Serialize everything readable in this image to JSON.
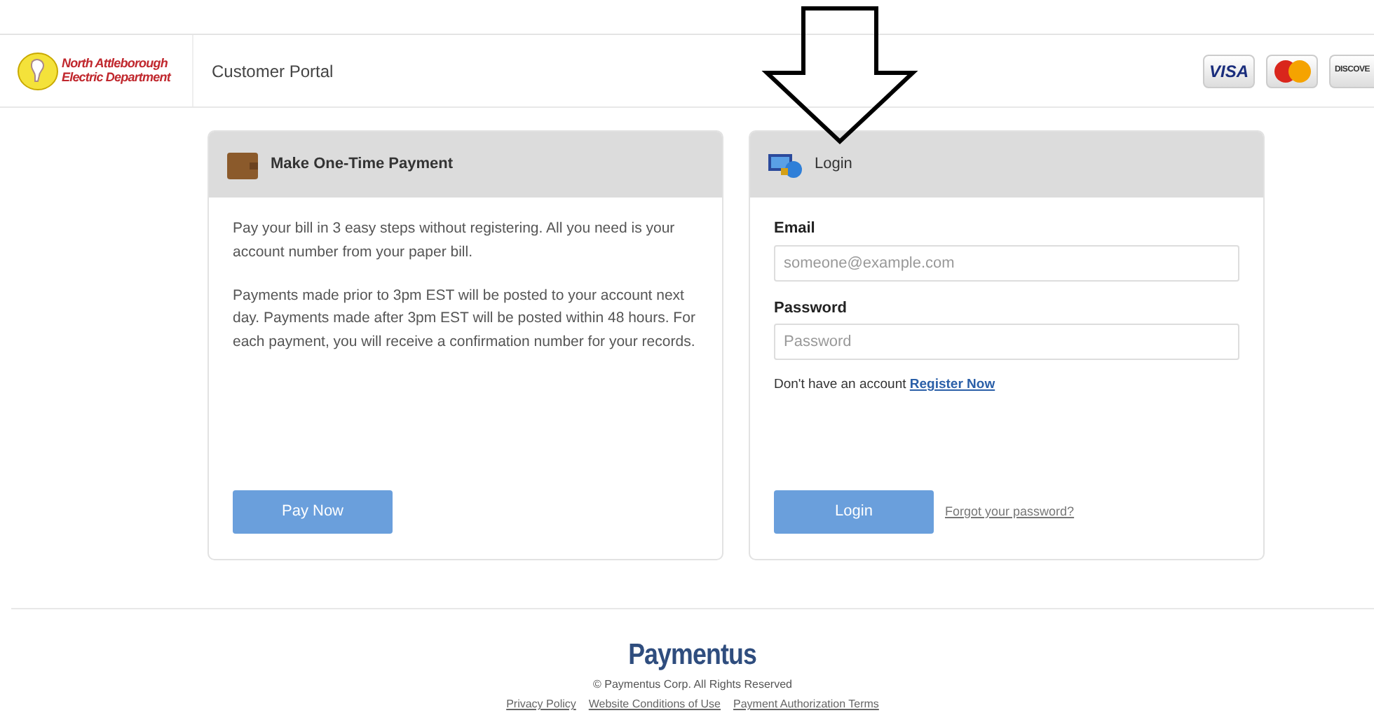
{
  "header": {
    "logo_text": [
      "North Attleborough",
      "Electric Department"
    ],
    "title": "Customer Portal",
    "card_logos": [
      {
        "kind": "visa",
        "text": "VISA"
      },
      {
        "kind": "mastercard"
      },
      {
        "kind": "discover",
        "text": "DISCOVE"
      }
    ]
  },
  "payment_panel": {
    "title": "Make One-Time Payment",
    "paragraphs": [
      "Pay your bill in 3 easy steps without registering. All you need is your account number from your paper bill.",
      "Payments made prior to 3pm EST will be posted to your account next day. Payments made after 3pm EST will be posted within 48 hours. For each payment, you will receive a confirmation number for your records."
    ],
    "button": "Pay Now"
  },
  "login_panel": {
    "title": "Login",
    "fields": [
      {
        "label": "Email",
        "placeholder": "someone@example.com"
      },
      {
        "label": "Password",
        "placeholder": "Password"
      }
    ],
    "register_prompt": "Don't have an account",
    "register_link": "Register Now",
    "button": "Login",
    "forgot_link": "Forgot your password?"
  },
  "footer": {
    "brand": "Paymentus",
    "copyright": "© Paymentus Corp. All Rights Reserved",
    "links": [
      "Privacy Policy",
      "Website Conditions of Use",
      "Payment Authorization Terms"
    ]
  }
}
